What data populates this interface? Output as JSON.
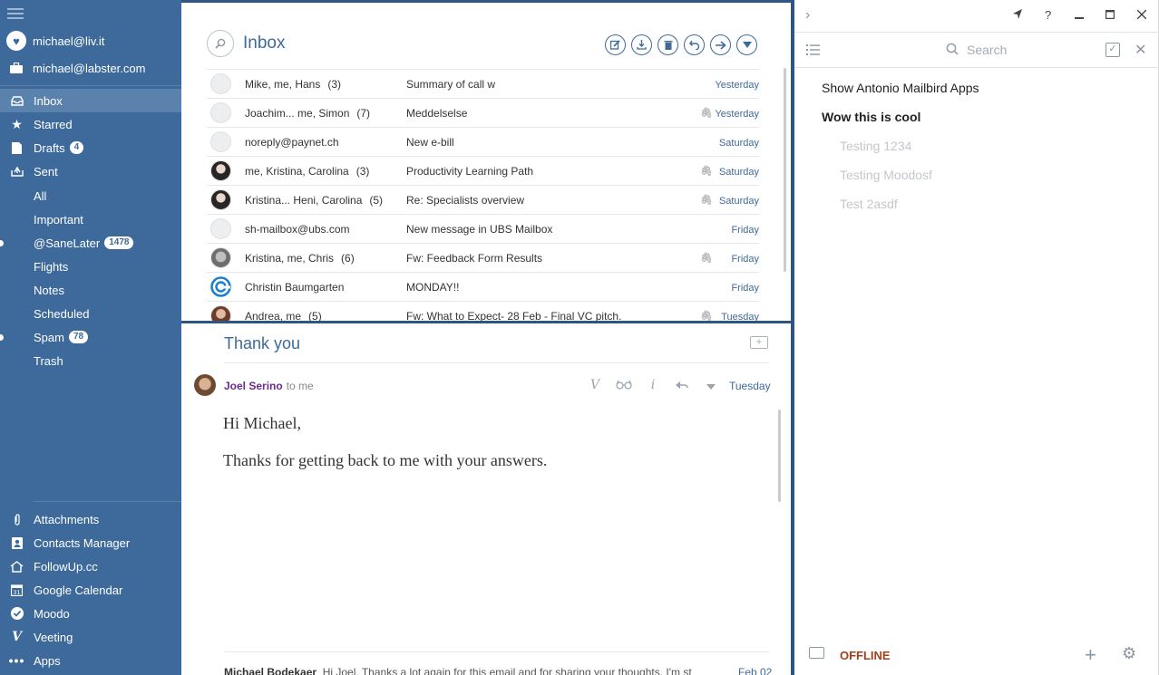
{
  "sidebar": {
    "accounts": [
      {
        "label": "michael@liv.it",
        "icon": "heart-icon"
      },
      {
        "label": "michael@labster.com",
        "icon": "briefcase-icon"
      }
    ],
    "folders": [
      {
        "label": "Inbox",
        "icon": "inbox-icon",
        "active": true
      },
      {
        "label": "Starred",
        "icon": "star-icon"
      },
      {
        "label": "Drafts",
        "icon": "drafts-icon",
        "badge": "4"
      },
      {
        "label": "Sent",
        "icon": "sent-icon"
      },
      {
        "label": "All"
      },
      {
        "label": "Important"
      },
      {
        "label": "@SaneLater",
        "badge": "1478"
      },
      {
        "label": "Flights"
      },
      {
        "label": "Notes"
      },
      {
        "label": "Scheduled"
      },
      {
        "label": "Spam",
        "badge": "78"
      },
      {
        "label": "Trash"
      }
    ],
    "apps": [
      {
        "label": "Attachments",
        "icon": "paperclip-icon"
      },
      {
        "label": "Contacts Manager",
        "icon": "contacts-icon"
      },
      {
        "label": "FollowUp.cc",
        "icon": "followup-icon"
      },
      {
        "label": "Google Calendar",
        "icon": "calendar-icon",
        "glyph": "31"
      },
      {
        "label": "Moodo",
        "icon": "moodo-check-icon"
      },
      {
        "label": "Veeting",
        "icon": "veeting-icon"
      },
      {
        "label": "Apps",
        "icon": "more-dots-icon"
      }
    ]
  },
  "inbox": {
    "title": "Inbox",
    "messages": [
      {
        "from": "Mike, me, Hans",
        "count": "(3)",
        "subject": "Summary of call w",
        "attach": false,
        "date": "Yesterday",
        "avatar": "blank"
      },
      {
        "from": "Joachim... me, Simon",
        "count": "(7)",
        "subject": "Meddelselse",
        "attach": true,
        "date": "Yesterday",
        "avatar": "blank"
      },
      {
        "from": "noreply@paynet.ch",
        "count": "",
        "subject": "New e-bill",
        "attach": false,
        "date": "Saturday",
        "avatar": "blank"
      },
      {
        "from": "me, Kristina, Carolina",
        "count": "(3)",
        "subject": "Productivity Learning Path",
        "attach": true,
        "date": "Saturday",
        "avatar": "dark"
      },
      {
        "from": "Kristina... Heni, Carolina",
        "count": "(5)",
        "subject": "Re: Specialists overview",
        "attach": true,
        "date": "Saturday",
        "avatar": "dark"
      },
      {
        "from": "sh-mailbox@ubs.com",
        "count": "",
        "subject": "New message in UBS Mailbox",
        "attach": false,
        "date": "Friday",
        "avatar": "blank"
      },
      {
        "from": "Kristina, me, Chris",
        "count": "(6)",
        "subject": "Fw: Feedback Form Results",
        "attach": true,
        "date": "Friday",
        "avatar": "gray"
      },
      {
        "from": "Christin Baumgarten",
        "count": "",
        "subject": "MONDAY!!",
        "attach": false,
        "date": "Friday",
        "avatar": "brand"
      },
      {
        "from": "Andrea, me",
        "count": "(5)",
        "subject": "Fw: What to Expect- 28 Feb - Final VC pitch.",
        "attach": true,
        "date": "Tuesday",
        "avatar": "pic"
      }
    ]
  },
  "reader": {
    "subject": "Thank you",
    "sender": "Joel Serino",
    "to": "to me",
    "date": "Tuesday",
    "body": [
      "Hi Michael,",
      "Thanks for getting back to me with your answers."
    ],
    "next_sender": "Michael Bodekaer",
    "next_preview": "Hi Joel, Thanks a lot again for this email and for sharing your thoughts. I'm st",
    "next_date": "Feb 02"
  },
  "tasks": {
    "search_placeholder": "Search",
    "items": [
      {
        "label": "Show Antonio Mailbird Apps",
        "level": 1,
        "bold": false
      },
      {
        "label": "Wow this is cool",
        "level": 1,
        "bold": true
      },
      {
        "label": "Testing 1234",
        "level": 2
      },
      {
        "label": "Testing Moodosf",
        "level": 2
      },
      {
        "label": "Test 2asdf",
        "level": 2
      }
    ],
    "status": "OFFLINE"
  },
  "window": {
    "controls": [
      "pin",
      "help",
      "minimize",
      "maximize",
      "close"
    ]
  }
}
